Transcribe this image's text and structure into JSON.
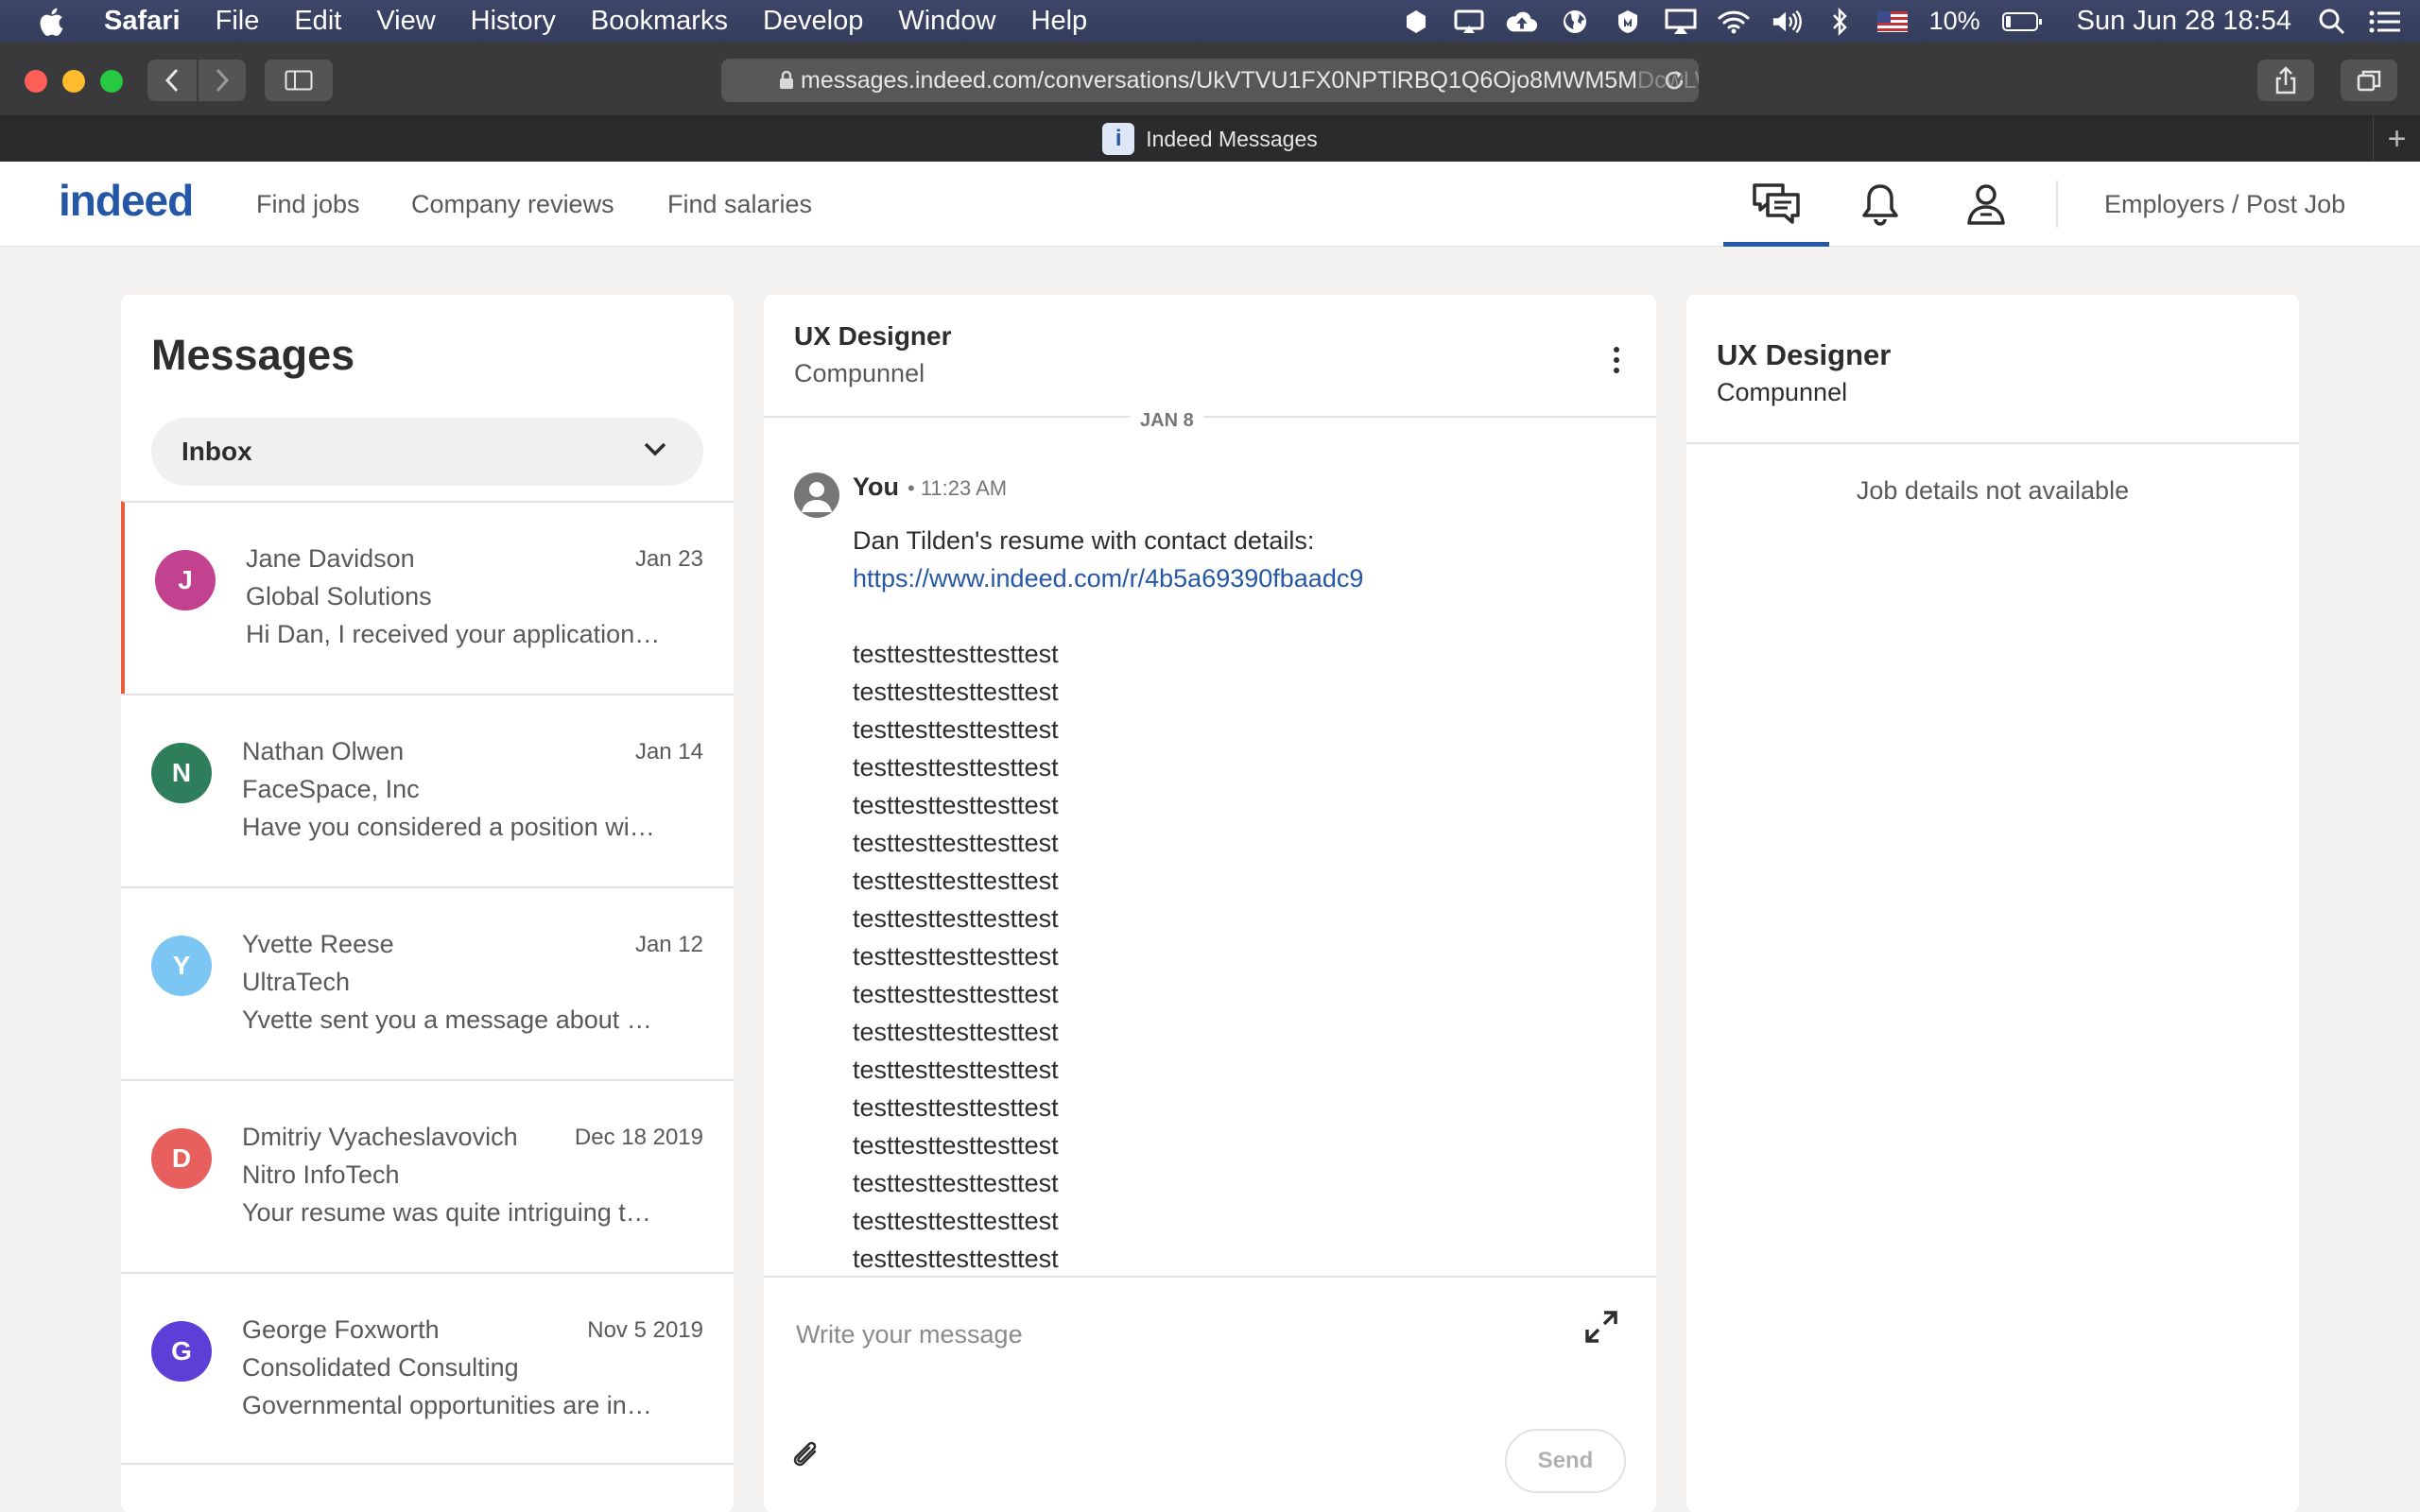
{
  "menubar": {
    "items": [
      "Safari",
      "File",
      "Edit",
      "View",
      "History",
      "Bookmarks",
      "Develop",
      "Window",
      "Help"
    ],
    "battery": "10%",
    "datetime": "Sun Jun 28  18:54"
  },
  "browser": {
    "url": "messages.indeed.com/conversations/UkVTVU1FX0NPTlRBQ1Q6Ojo8MWM5M",
    "url_fade": "DcwLWQ",
    "tab_title": "Indeed Messages",
    "favicon": "i"
  },
  "nav": {
    "logo": "indeed",
    "links": [
      "Find jobs",
      "Company reviews",
      "Find salaries"
    ],
    "employers": "Employers / Post Job"
  },
  "messages": {
    "title": "Messages",
    "filter": "Inbox",
    "conversations": [
      {
        "initial": "J",
        "name": "Jane Davidson",
        "date": "Jan 23",
        "company": "Global Solutions",
        "preview": "Hi Dan, I received your application for the UX Designer role",
        "color": "#c2428f"
      },
      {
        "initial": "N",
        "name": "Nathan Olwen",
        "date": "Jan 14",
        "company": "FaceSpace, Inc",
        "preview": "Have you considered a position with our design team",
        "color": "#2e7d5b"
      },
      {
        "initial": "Y",
        "name": "Yvette Reese",
        "date": "Jan 12",
        "company": "UltraTech",
        "preview": "Yvette sent you a message about a new opening",
        "color": "#7cc6f4"
      },
      {
        "initial": "D",
        "name": "Dmitriy Vyacheslavovich",
        "date": "Dec 18 2019",
        "company": "Nitro InfoTech",
        "preview": "Your resume was quite intriguing to our recruiters",
        "color": "#e8605e"
      },
      {
        "initial": "G",
        "name": "George Foxworth",
        "date": "Nov 5 2019",
        "company": "Consolidated Consulting",
        "preview": "Governmental opportunities are in high demand",
        "color": "#5b3fd6"
      }
    ]
  },
  "conversation": {
    "title": "UX Designer",
    "company": "Compunnel",
    "date_separator": "JAN 8",
    "sender": "You",
    "time": "• 11:23 AM",
    "intro": "Dan Tilden's resume with contact details:",
    "link": "https://www.indeed.com/r/4b5a69390fbaadc9",
    "lines": [
      "testtesttesttesttest",
      "testtesttesttesttest",
      "testtesttesttesttest",
      "testtesttesttesttest",
      "testtesttesttesttest",
      "testtesttesttesttest",
      "testtesttesttesttest",
      "testtesttesttesttest",
      "testtesttesttesttest",
      "testtesttesttesttest",
      "testtesttesttesttest",
      "testtesttesttesttest",
      "testtesttesttesttest",
      "testtesttesttesttest",
      "testtesttesttesttest",
      "testtesttesttesttest",
      "testtesttesttesttest"
    ],
    "compose_placeholder": "Write your message",
    "send": "Send"
  },
  "job_panel": {
    "title": "UX Designer",
    "company": "Compunnel",
    "note": "Job details not available"
  }
}
